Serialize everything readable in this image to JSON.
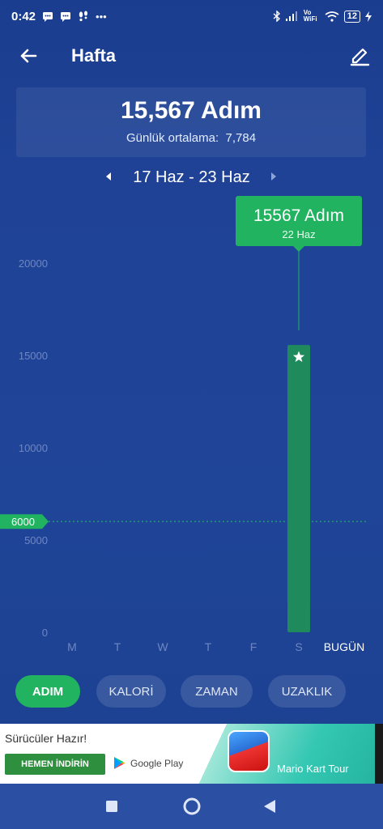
{
  "status_bar": {
    "time": "0:42",
    "icons_left": [
      "message-icon",
      "message-icon",
      "footsteps-icon",
      "more-dots-icon"
    ],
    "vowifi": "Vo WiFi",
    "battery": "12"
  },
  "header": {
    "title": "Hafta",
    "back_icon": "arrow-left-icon",
    "edit_icon": "pencil-icon"
  },
  "summary": {
    "total": "15,567 Adım",
    "average_label": "Günlük ortalama:",
    "average_value": "7,784"
  },
  "date_nav": {
    "range": "17 Haz - 23 Haz"
  },
  "chart_data": {
    "type": "bar",
    "categories": [
      "M",
      "T",
      "W",
      "T",
      "F",
      "S",
      "BUGÜN"
    ],
    "values": [
      0,
      0,
      0,
      0,
      0,
      15567,
      0
    ],
    "y_ticks": [
      "0",
      "5000",
      "10000",
      "15000",
      "20000"
    ],
    "ylim": [
      0,
      20000
    ],
    "goal_line": {
      "value": 6000,
      "label": "6000"
    },
    "tooltip": {
      "title": "15567 Adım",
      "subtitle": "22 Haz",
      "index": 5
    },
    "bar_color": "#1f8a5b",
    "accent_color": "#21b35f",
    "grid": false
  },
  "tabs": [
    {
      "label": "ADIM",
      "active": true
    },
    {
      "label": "KALORİ",
      "active": false
    },
    {
      "label": "ZAMAN",
      "active": false
    },
    {
      "label": "UZAKLIK",
      "active": false
    }
  ],
  "ad": {
    "headline": "Sürücüler Hazır!",
    "cta": "HEMEN İNDİRİN",
    "store": "Google Play",
    "app_name": "Mario Kart Tour"
  },
  "nav_bar": {
    "buttons": [
      "recents-square-icon",
      "home-circle-icon",
      "back-triangle-icon"
    ]
  }
}
